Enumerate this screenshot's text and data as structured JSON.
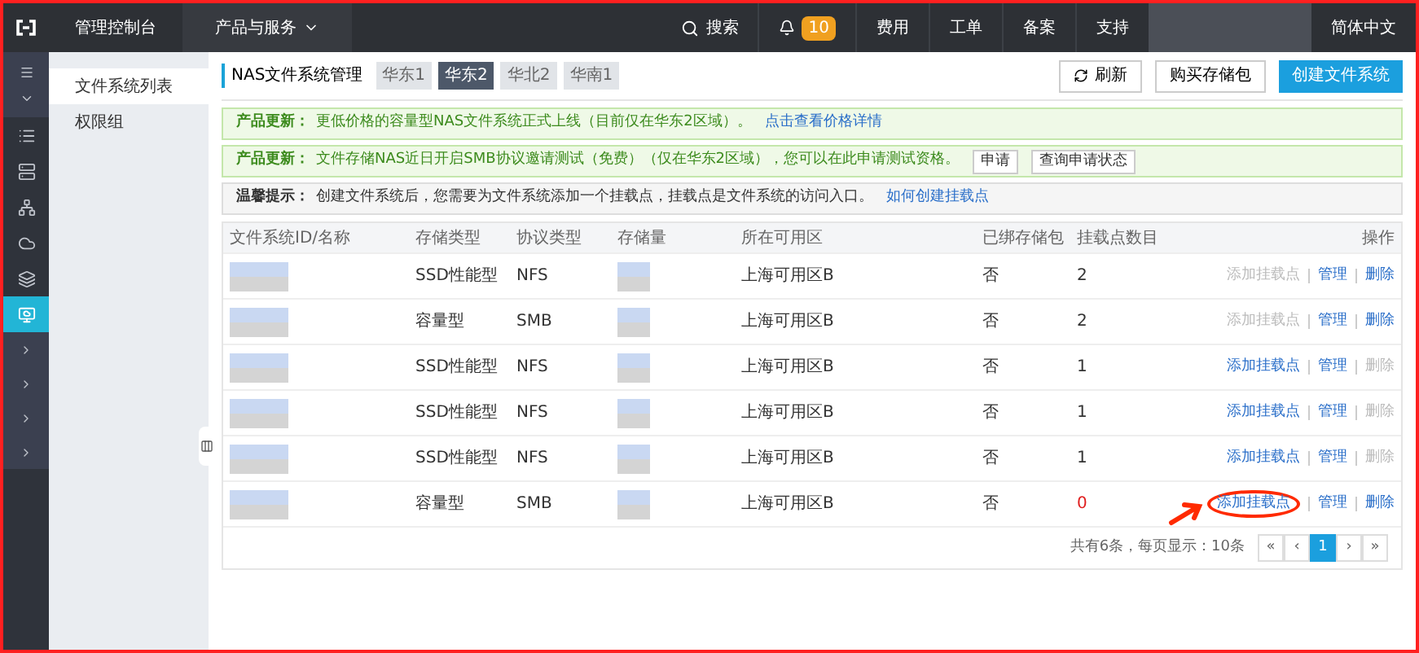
{
  "topbar": {
    "console": "管理控制台",
    "products": "产品与服务",
    "search": "搜索",
    "notifications": "10",
    "links": [
      "费用",
      "工单",
      "备案",
      "支持"
    ],
    "language": "简体中文"
  },
  "sidebar": {
    "items": [
      {
        "label": "文件系统列表",
        "selected": true
      },
      {
        "label": "权限组",
        "selected": false
      }
    ]
  },
  "header": {
    "title": "NAS文件系统管理",
    "regions": [
      {
        "label": "华东1",
        "selected": false
      },
      {
        "label": "华东2",
        "selected": true
      },
      {
        "label": "华北2",
        "selected": false
      },
      {
        "label": "华南1",
        "selected": false
      }
    ],
    "refresh": "刷新",
    "buy": "购买存储包",
    "create": "创建文件系统"
  },
  "notices": [
    {
      "kind": "update",
      "label": "产品更新：",
      "text": "更低价格的容量型NAS文件系统正式上线（目前仅在华东2区域）。",
      "link": "点击查看价格详情"
    },
    {
      "kind": "update",
      "label": "产品更新：",
      "text": "文件存储NAS近日开启SMB协议邀请测试（免费）（仅在华东2区域），您可以在此申请测试资格。",
      "buttons": [
        "申请",
        "查询申请状态"
      ]
    },
    {
      "kind": "tip",
      "label": "温馨提示：",
      "text": "创建文件系统后，您需要为文件系统添加一个挂载点，挂载点是文件系统的访问入口。",
      "link": "如何创建挂载点"
    }
  ],
  "table": {
    "columns": [
      "文件系统ID/名称",
      "存储类型",
      "协议类型",
      "存储量",
      "所在可用区",
      "已绑存储包",
      "挂载点数目",
      "操作"
    ],
    "rows": [
      {
        "storage_type": "SSD性能型",
        "protocol": "NFS",
        "zone": "上海可用区B",
        "bound": "否",
        "mounts": "2",
        "zero": false,
        "add": "添加挂载点",
        "add_disabled": true,
        "manage": "管理",
        "delete": "删除",
        "delete_disabled": false,
        "annotated": false
      },
      {
        "storage_type": "容量型",
        "protocol": "SMB",
        "zone": "上海可用区B",
        "bound": "否",
        "mounts": "2",
        "zero": false,
        "add": "添加挂载点",
        "add_disabled": true,
        "manage": "管理",
        "delete": "删除",
        "delete_disabled": false,
        "annotated": false
      },
      {
        "storage_type": "SSD性能型",
        "protocol": "NFS",
        "zone": "上海可用区B",
        "bound": "否",
        "mounts": "1",
        "zero": false,
        "add": "添加挂载点",
        "add_disabled": false,
        "manage": "管理",
        "delete": "删除",
        "delete_disabled": true,
        "annotated": false
      },
      {
        "storage_type": "SSD性能型",
        "protocol": "NFS",
        "zone": "上海可用区B",
        "bound": "否",
        "mounts": "1",
        "zero": false,
        "add": "添加挂载点",
        "add_disabled": false,
        "manage": "管理",
        "delete": "删除",
        "delete_disabled": true,
        "annotated": false
      },
      {
        "storage_type": "SSD性能型",
        "protocol": "NFS",
        "zone": "上海可用区B",
        "bound": "否",
        "mounts": "1",
        "zero": false,
        "add": "添加挂载点",
        "add_disabled": false,
        "manage": "管理",
        "delete": "删除",
        "delete_disabled": true,
        "annotated": false
      },
      {
        "storage_type": "容量型",
        "protocol": "SMB",
        "zone": "上海可用区B",
        "bound": "否",
        "mounts": "0",
        "zero": true,
        "add": "添加挂载点",
        "add_disabled": false,
        "manage": "管理",
        "delete": "删除",
        "delete_disabled": false,
        "annotated": true
      }
    ]
  },
  "pagination": {
    "summary": "共有6条，每页显示：10条",
    "pages": [
      {
        "label": "«",
        "selected": false
      },
      {
        "label": "‹",
        "selected": false
      },
      {
        "label": "1",
        "selected": true
      },
      {
        "label": "›",
        "selected": false
      },
      {
        "label": "»",
        "selected": false
      }
    ]
  }
}
